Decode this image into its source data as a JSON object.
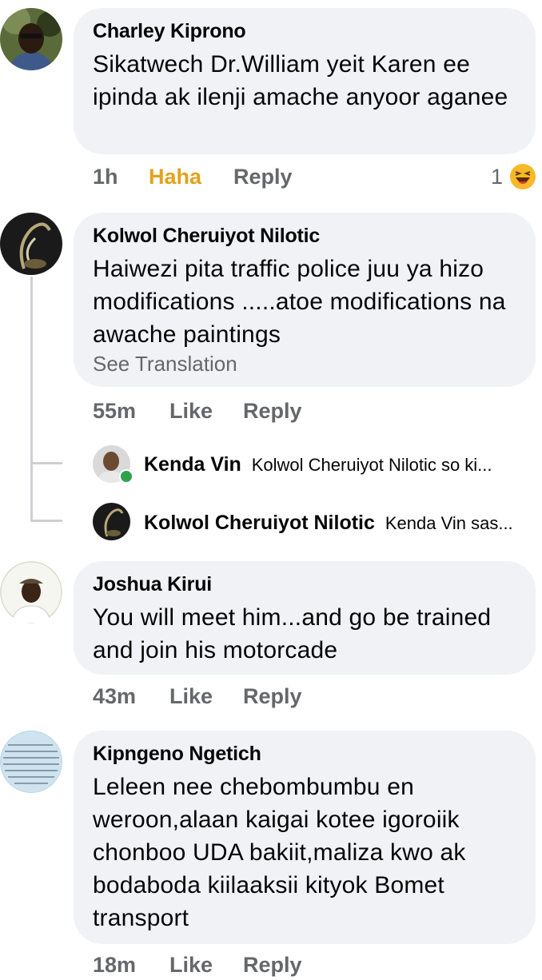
{
  "comments": [
    {
      "author": "Charley Kiprono",
      "text": "Sikatwech Dr.William yeit Karen ee ipinda ak ilenji amache anyoor aganee",
      "time": "1h",
      "reaction_label": "Haha",
      "reply_label": "Reply",
      "reaction_count": "1",
      "reaction_icon": "haha-emoji"
    },
    {
      "author": "Kolwol Cheruiyot Nilotic",
      "text": "Haiwezi pita traffic police juu ya hizo modifications .....atoe modifications na awache paintings",
      "see_translation": "See Translation",
      "time": "55m",
      "like_label": "Like",
      "reply_label": "Reply",
      "replies": [
        {
          "author": "Kenda Vin",
          "text": "Kolwol Cheruiyot Nilotic so ki..."
        },
        {
          "author": "Kolwol Cheruiyot Nilotic",
          "text": "Kenda Vin sas..."
        }
      ]
    },
    {
      "author": "Joshua Kirui",
      "text": "You will meet him...and go be trained and join his motorcade",
      "time": "43m",
      "like_label": "Like",
      "reply_label": "Reply"
    },
    {
      "author": "Kipngeno Ngetich",
      "text": "Leleen nee chebombumbu en weroon,alaan kaigai kotee igoroiik chonboo UDA bakiit,maliza kwo ak bodaboda kiilaaksii kityok Bomet transport",
      "time": "18m",
      "like_label": "Like",
      "reply_label": "Reply"
    }
  ],
  "colors": {
    "bubble": "#f0f2f5",
    "meta": "#65676b",
    "haha": "#e4a11b",
    "online": "#31a24c"
  }
}
